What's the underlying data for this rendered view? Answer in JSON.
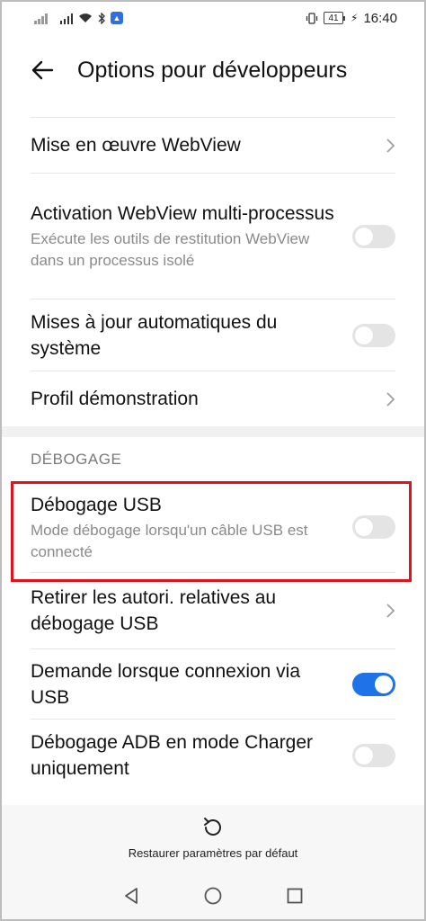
{
  "status_bar": {
    "battery": "41",
    "time": "16:40"
  },
  "header": {
    "title": "Options pour développeurs"
  },
  "rows_top": [
    {
      "title": "Mise en œuvre WebView",
      "subtitle": "",
      "control": "chevron"
    },
    {
      "title": "Activation WebView multi-processus",
      "subtitle": "Exécute les outils de restitution WebView dans un processus isolé",
      "control": "toggle",
      "on": false
    },
    {
      "title": "Mises à jour automatiques du système",
      "subtitle": "",
      "control": "toggle",
      "on": false
    },
    {
      "title": "Profil démonstration",
      "subtitle": "",
      "control": "chevron"
    }
  ],
  "debug_section": {
    "header": "DÉBOGAGE",
    "rows": [
      {
        "title": "Débogage USB",
        "subtitle": "Mode débogage lorsqu'un câble USB est connecté",
        "control": "toggle",
        "on": false
      },
      {
        "title": "Retirer les autori. relatives au débogage USB",
        "subtitle": "",
        "control": "chevron"
      },
      {
        "title": "Demande lorsque connexion via USB",
        "subtitle": "",
        "control": "toggle",
        "on": true
      },
      {
        "title": "Débogage ADB en mode Charger uniquement",
        "subtitle": "",
        "control": "toggle",
        "on": false
      }
    ]
  },
  "bottom": {
    "restore_label": "Restaurer paramètres par défaut"
  },
  "colors": {
    "accent": "#1f72e8",
    "highlight": "#e3121a"
  }
}
